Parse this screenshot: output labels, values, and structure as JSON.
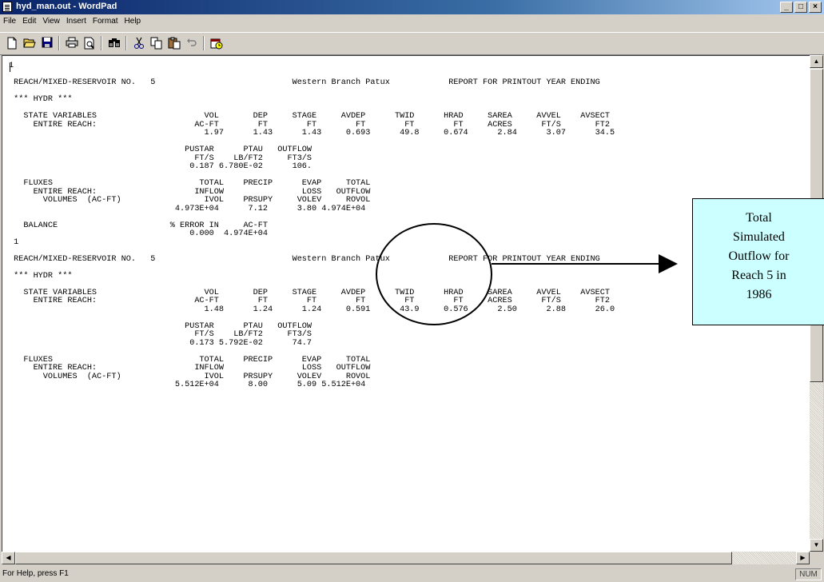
{
  "window": {
    "title": "hyd_man.out - WordPad",
    "minimize_label": "_",
    "maximize_label": "□",
    "close_label": "×"
  },
  "menu": [
    "File",
    "Edit",
    "View",
    "Insert",
    "Format",
    "Help"
  ],
  "toolbar": {
    "icons": [
      "new-icon",
      "open-icon",
      "save-icon",
      "print-icon",
      "print-preview-icon",
      "find-icon",
      "cut-icon",
      "copy-icon",
      "paste-icon",
      "undo-icon",
      "insert-datetime-icon"
    ]
  },
  "document": {
    "lines": [
      "1",
      "",
      " REACH/MIXED-RESERVOIR NO.   5                            Western Branch Patux            REPORT FOR PRINTOUT YEAR ENDING",
      "",
      " *** HYDR ***",
      "",
      "   STATE VARIABLES                      VOL       DEP     STAGE     AVDEP      TWID      HRAD     SAREA     AVVEL    AVSECT",
      "     ENTIRE REACH:                    AC-FT        FT        FT        FT        FT        FT     ACRES      FT/S       FT2",
      "                                        1.97      1.43      1.43     0.693      49.8     0.674      2.84      3.07      34.5",
      "",
      "                                    PUSTAR      PTAU   OUTFLOW",
      "                                      FT/S    LB/FT2     FT3/S",
      "                                     0.187 6.780E-02      106.",
      "",
      "   FLUXES                              TOTAL    PRECIP      EVAP     TOTAL",
      "     ENTIRE REACH:                    INFLOW                LOSS   OUTFLOW",
      "       VOLUMES  (AC-FT)                 IVOL    PRSUPY     VOLEV     ROVOL",
      "                                  4.973E+04      7.12      3.80 4.974E+04",
      "",
      "   BALANCE                       % ERROR IN     AC-FT",
      "                                     0.000  4.974E+04",
      " 1",
      "",
      " REACH/MIXED-RESERVOIR NO.   5                            Western Branch Patux            REPORT FOR PRINTOUT YEAR ENDING",
      "",
      " *** HYDR ***",
      "",
      "   STATE VARIABLES                      VOL       DEP     STAGE     AVDEP      TWID      HRAD     SAREA     AVVEL    AVSECT",
      "     ENTIRE REACH:                    AC-FT        FT        FT        FT        FT        FT     ACRES      FT/S       FT2",
      "                                        1.48      1.24      1.24     0.591      43.9     0.576      2.50      2.88      26.0",
      "",
      "                                    PUSTAR      PTAU   OUTFLOW",
      "                                      FT/S    LB/FT2     FT3/S",
      "                                     0.173 5.792E-02      74.7",
      "",
      "   FLUXES                              TOTAL    PRECIP      EVAP     TOTAL",
      "     ENTIRE REACH:                    INFLOW                LOSS   OUTFLOW",
      "       VOLUMES  (AC-FT)                 IVOL    PRSUPY     VOLEV     ROVOL",
      "                                  5.512E+04      8.00      5.09 5.512E+04"
    ]
  },
  "callout": {
    "lines": [
      "Total",
      "Simulated",
      "Outflow for",
      "Reach 5 in",
      "1986"
    ],
    "background": "#ccffff"
  },
  "statusbar": {
    "help_text": "For Help, press F1",
    "num_indicator": "NUM"
  },
  "colors": {
    "title_gradient_start": "#0a246a",
    "title_gradient_end": "#a6caf0",
    "chrome": "#d4d0c8"
  }
}
